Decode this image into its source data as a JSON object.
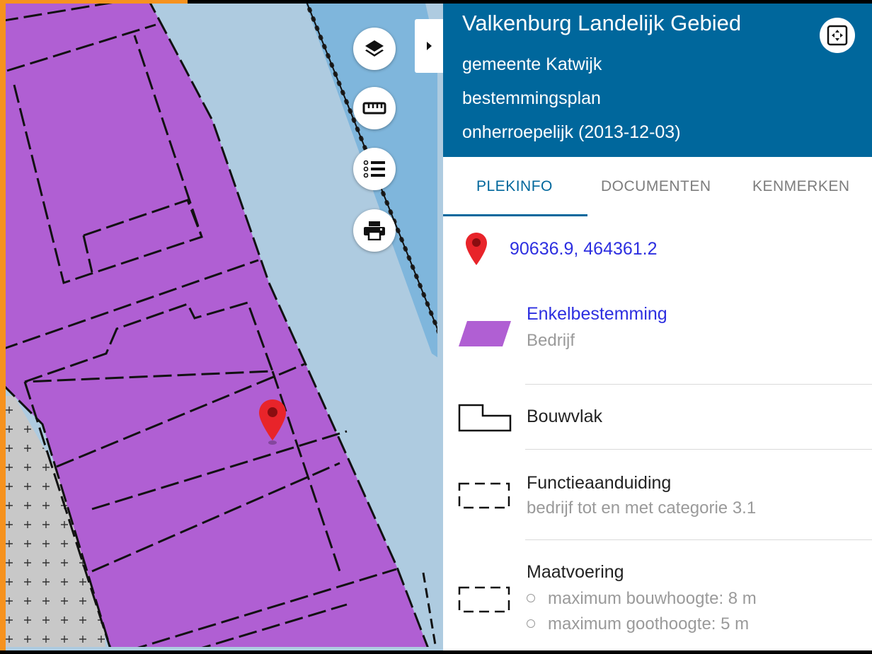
{
  "panel": {
    "title": "Valkenburg Landelijk Gebied",
    "municipality": "gemeente Katwijk",
    "plan_type": "bestemmingsplan",
    "status": "onherroepelijk (2013-12-03)"
  },
  "tabs": [
    {
      "label": "PLEKINFO",
      "active": true
    },
    {
      "label": "DOCUMENTEN",
      "active": false
    },
    {
      "label": "KENMERKEN",
      "active": false
    }
  ],
  "location": {
    "coordinates": "90636.9, 464361.2"
  },
  "legend": [
    {
      "title": "Enkelbestemming",
      "subtitle": "Bedrijf",
      "symbol": "purple-parallelogram"
    },
    {
      "title": "Bouwvlak",
      "symbol": "building-outline"
    },
    {
      "title": "Functieaanduiding",
      "subtitle": "bedrijf tot en met categorie 3.1",
      "symbol": "dashed-rectangle"
    },
    {
      "title": "Maatvoering",
      "bullets": [
        "maximum bouwhoogte: 8 m",
        "maximum goothoogte: 5 m"
      ],
      "symbol": "dashed-rectangle"
    }
  ],
  "map": {
    "tools": [
      "layers-icon",
      "ruler-icon",
      "list-icon",
      "print-icon"
    ],
    "colors": {
      "water": "#aecbe0",
      "bedrijf": "#b05fd3",
      "unbuilt": "#c8c8c8",
      "marker": "#e8242a"
    }
  },
  "colors": {
    "header": "#00679c",
    "accent": "#2d2fe0",
    "frame": "#f6921e"
  }
}
